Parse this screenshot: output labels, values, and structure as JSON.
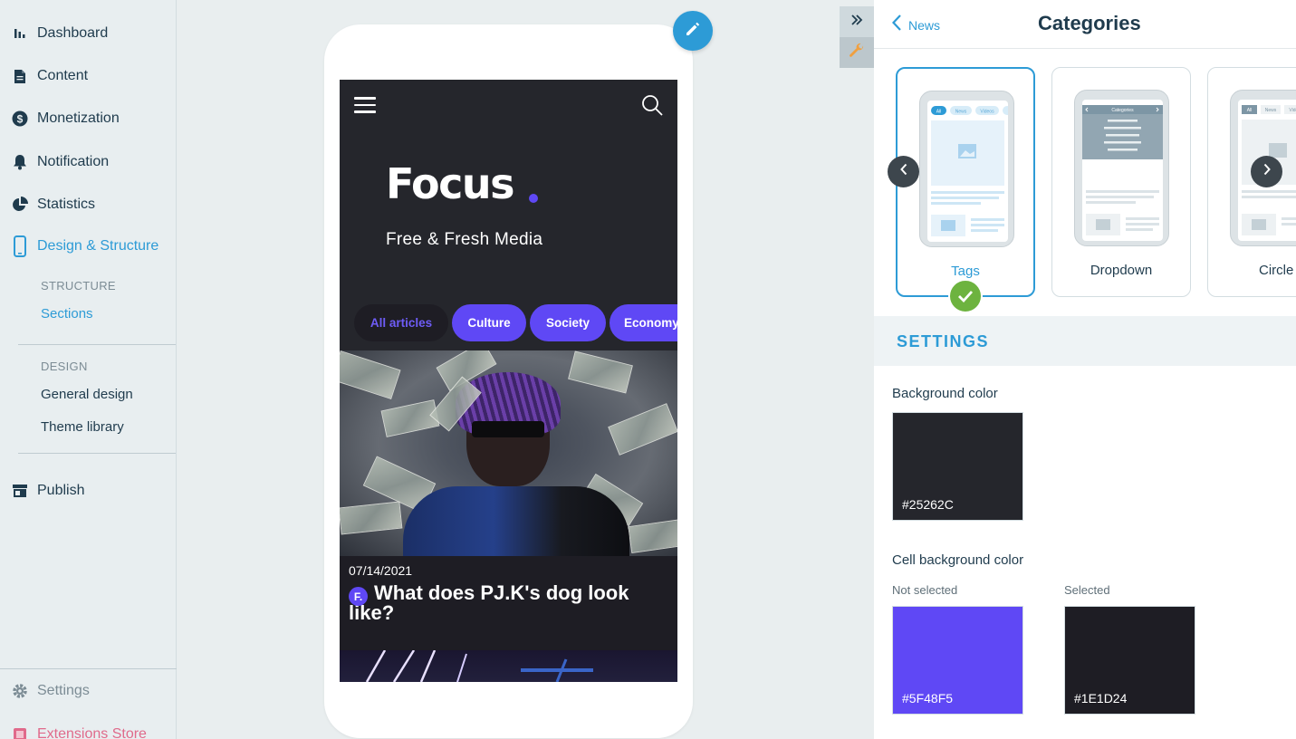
{
  "sidebar": {
    "items": [
      {
        "label": "Dashboard",
        "icon": "bar-chart-icon"
      },
      {
        "label": "Content",
        "icon": "document-icon"
      },
      {
        "label": "Monetization",
        "icon": "dollar-icon"
      },
      {
        "label": "Notification",
        "icon": "bell-icon"
      },
      {
        "label": "Statistics",
        "icon": "pie-chart-icon"
      },
      {
        "label": "Design & Structure",
        "icon": "mobile-icon"
      }
    ],
    "structure_heading": "STRUCTURE",
    "sections_label": "Sections",
    "design_heading": "DESIGN",
    "general_design_label": "General design",
    "theme_library_label": "Theme library",
    "publish_label": "Publish",
    "settings_label": "Settings",
    "extensions_label": "Extensions Store"
  },
  "preview": {
    "logo": "Focus",
    "tagline": "Free & Fresh Media",
    "tabs": [
      "All articles",
      "Culture",
      "Society",
      "Economy"
    ],
    "article": {
      "date": "07/14/2021",
      "badge": "F.",
      "title": "What does PJ.K's dog look like?"
    }
  },
  "panel": {
    "back_label": "News",
    "title": "Categories",
    "layouts": [
      {
        "label": "Tags",
        "selected": true
      },
      {
        "label": "Dropdown",
        "selected": false
      },
      {
        "label": "Circle Ba",
        "selected": false
      }
    ],
    "mini": {
      "tag_labels": [
        "All",
        "News",
        "Videos"
      ],
      "dropdown_title": "Categories"
    },
    "settings_title": "SETTINGS",
    "background_color_label": "Background color",
    "background_color": "#25262C",
    "cell_bg_label": "Cell background color",
    "not_selected_label": "Not selected",
    "not_selected_color": "#5F48F5",
    "selected_label": "Selected",
    "selected_color": "#1E1D24"
  },
  "colors": {
    "accent": "#2d9bd6",
    "brand_purple": "#5f48f5",
    "success": "#6db33f"
  }
}
